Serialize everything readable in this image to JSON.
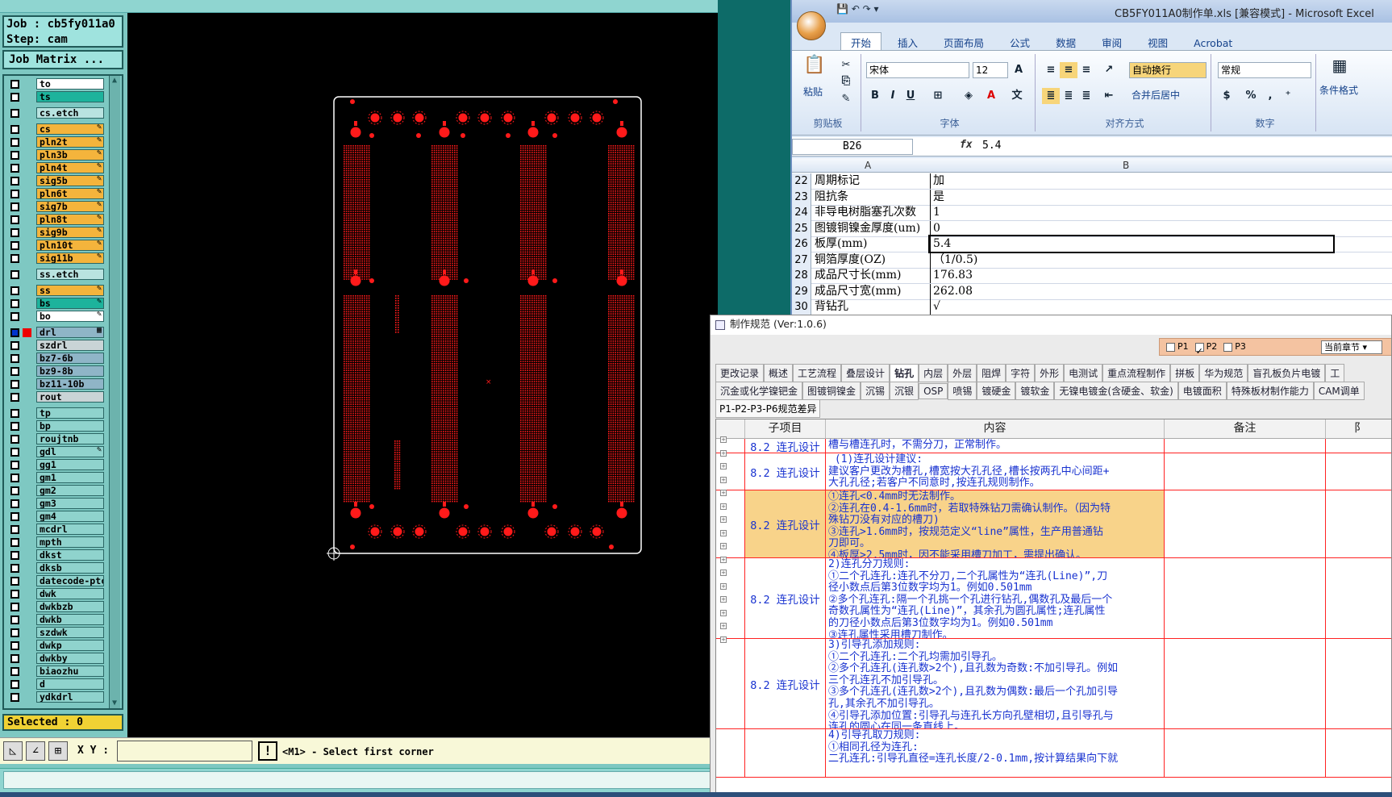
{
  "cam": {
    "job_line": "Job : cb5fy011a0",
    "step_line": "Step: cam",
    "job_matrix": "Job Matrix ...",
    "selected": "Selected : 0",
    "xy_label": "X Y :",
    "xy_value": "",
    "bang": "!",
    "prompt": "<M1> - Select first corner",
    "layers": [
      {
        "name": "to",
        "color": "white",
        "pen": ""
      },
      {
        "name": "ts",
        "color": "teal",
        "pen": ""
      },
      {
        "sep": true
      },
      {
        "name": "cs.etch",
        "color": "light",
        "pen": ""
      },
      {
        "sep": true
      },
      {
        "name": "cs",
        "color": "orange",
        "pen": "✎"
      },
      {
        "name": "pln2t",
        "color": "orange",
        "pen": "✎"
      },
      {
        "name": "pln3b",
        "color": "orange",
        "pen": "✎"
      },
      {
        "name": "pln4t",
        "color": "orange",
        "pen": "✎"
      },
      {
        "name": "sig5b",
        "color": "orange",
        "pen": "✎"
      },
      {
        "name": "pln6t",
        "color": "orange",
        "pen": "✎"
      },
      {
        "name": "sig7b",
        "color": "orange",
        "pen": "✎"
      },
      {
        "name": "pln8t",
        "color": "orange",
        "pen": "✎"
      },
      {
        "name": "sig9b",
        "color": "orange",
        "pen": "✎"
      },
      {
        "name": "pln10t",
        "color": "orange",
        "pen": "✎"
      },
      {
        "name": "sig11b",
        "color": "orange",
        "pen": "✎"
      },
      {
        "sep": true
      },
      {
        "name": "ss.etch",
        "color": "light",
        "pen": ""
      },
      {
        "sep": true
      },
      {
        "name": "ss",
        "color": "orange",
        "pen": "✎"
      },
      {
        "name": "bs",
        "color": "teal",
        "pen": "✎"
      },
      {
        "name": "bo",
        "color": "white",
        "pen": "✎"
      },
      {
        "sep": true
      },
      {
        "name": "drl",
        "color": "blue",
        "pen": "▦"
      },
      {
        "name": "szdrl",
        "color": "gray",
        "pen": ""
      },
      {
        "name": "bz7-6b",
        "color": "blue",
        "pen": ""
      },
      {
        "name": "bz9-8b",
        "color": "blue",
        "pen": ""
      },
      {
        "name": "bz11-10b",
        "color": "blue",
        "pen": ""
      },
      {
        "name": "rout",
        "color": "gray",
        "pen": ""
      },
      {
        "sep": true
      },
      {
        "name": "tp",
        "color": "cyan",
        "pen": ""
      },
      {
        "name": "bp",
        "color": "cyan",
        "pen": ""
      },
      {
        "name": "roujtnb",
        "color": "cyan",
        "pen": ""
      },
      {
        "name": "gdl",
        "color": "cyan",
        "pen": "✎"
      },
      {
        "name": "gg1",
        "color": "cyan",
        "pen": ""
      },
      {
        "name": "gm1",
        "color": "cyan",
        "pen": ""
      },
      {
        "name": "gm2",
        "color": "cyan",
        "pen": ""
      },
      {
        "name": "gm3",
        "color": "cyan",
        "pen": ""
      },
      {
        "name": "gm4",
        "color": "cyan",
        "pen": ""
      },
      {
        "name": "mcdrl",
        "color": "cyan",
        "pen": ""
      },
      {
        "name": "mpth",
        "color": "cyan",
        "pen": ""
      },
      {
        "name": "dkst",
        "color": "cyan",
        "pen": ""
      },
      {
        "name": "dksb",
        "color": "cyan",
        "pen": ""
      },
      {
        "name": "datecode-ptc",
        "color": "cyan",
        "pen": ""
      },
      {
        "name": "dwk",
        "color": "cyan",
        "pen": ""
      },
      {
        "name": "dwkbzb",
        "color": "cyan",
        "pen": ""
      },
      {
        "name": "dwkb",
        "color": "cyan",
        "pen": ""
      },
      {
        "name": "szdwk",
        "color": "cyan",
        "pen": ""
      },
      {
        "name": "dwkp",
        "color": "cyan",
        "pen": ""
      },
      {
        "name": "dwkby",
        "color": "cyan",
        "pen": ""
      },
      {
        "name": "biaozhu",
        "color": "cyan",
        "pen": ""
      },
      {
        "name": "d",
        "color": "cyan",
        "pen": ""
      },
      {
        "name": "ydkdrl",
        "color": "cyan",
        "pen": ""
      }
    ],
    "colors": {
      "white": "#ffffff",
      "teal": "#1db39c",
      "orange": "#f4b43c",
      "blue": "#8fb5c7",
      "gray": "#c9d4d6",
      "light": "#b9e3e0",
      "cyan": "#8fd3cd",
      "pad": "#ff1a1a"
    }
  },
  "excel": {
    "title": "CB5FY011A0制作单.xls [兼容模式] - Microsoft Excel",
    "tabs": [
      "开始",
      "插入",
      "页面布局",
      "公式",
      "数据",
      "审阅",
      "视图",
      "Acrobat"
    ],
    "font_name": "宋体",
    "font_size": "12",
    "wrap_text": "自动换行",
    "merge_center": "合并后居中",
    "number_format": "常规",
    "cond_format": "条件格式",
    "paste": "粘贴",
    "groups": {
      "clipboard": "剪贴板",
      "font": "字体",
      "align": "对齐方式",
      "number": "数字"
    },
    "name_box": "B26",
    "formula": "5.4",
    "col_a": "A",
    "col_b": "B",
    "rows": [
      {
        "n": "22",
        "a": "周期标记",
        "b": "加"
      },
      {
        "n": "23",
        "a": "阻抗条",
        "b": "是"
      },
      {
        "n": "24",
        "a": "非导电树脂塞孔次数",
        "b": "1"
      },
      {
        "n": "25",
        "a": "图镀铜镍金厚度(um)",
        "b": "0"
      },
      {
        "n": "26",
        "a": "板厚(mm)",
        "b": "5.4"
      },
      {
        "n": "27",
        "a": "铜箔厚度(OZ)",
        "b": "（1/0.5)"
      },
      {
        "n": "28",
        "a": "成品尺寸长(mm)",
        "b": "176.83"
      },
      {
        "n": "29",
        "a": "成品尺寸宽(mm)",
        "b": "262.08"
      },
      {
        "n": "30",
        "a": "背钻孔",
        "b": "√"
      }
    ]
  },
  "spec": {
    "title": "制作规范 (Ver:1.0.6)",
    "filters": [
      "P1",
      "P2",
      "P3"
    ],
    "chapter": "当前章节",
    "tabs1": [
      "更改记录",
      "概述",
      "工艺流程",
      "叠层设计",
      "钻孔",
      "内层",
      "外层",
      "阻焊",
      "字符",
      "外形",
      "电测试",
      "重点流程制作",
      "拼板",
      "华为规范",
      "盲孔板负片电镀",
      "工"
    ],
    "tabs2": [
      "沉金或化学镍钯金",
      "图镀铜镍金",
      "沉锡",
      "沉银",
      "OSP",
      "喷锡",
      "镀硬金",
      "镀软金",
      "无镍电镀金(含硬金、软金)",
      "电镀面积",
      "特殊板材制作能力",
      "CAM调单"
    ],
    "tab3": "P1-P2-P3-P6规范差异",
    "headers": {
      "sub": "子项目",
      "content": "内容",
      "note": "备注",
      "last": "阝"
    },
    "rows": [
      {
        "sub": "8.2 连孔设计",
        "content": "槽与槽连孔时，不需分刀，正常制作。",
        "h": 18,
        "hl": false
      },
      {
        "sub": "8.2 连孔设计",
        "content": " (1)连孔设计建议:\n建议客户更改为槽孔,槽宽按大孔孔径,槽长按两孔中心间距+\n大孔孔径;若客户不同意时,按连孔规则制作。",
        "h": 46,
        "hl": false
      },
      {
        "sub": "8.2 连孔设计",
        "content": "①连孔<0.4mm时无法制作。\n②连孔在0.4-1.6mm时，若取特殊钻刀需确认制作。（因为特\n殊钻刀没有对应的槽刀)\n③连孔>1.6mm时，按规范定义“line”属性，生产用普通钻\n刀即可。\n④板厚>2.5mm时，因不能采用槽刀加工，需提出确认。",
        "h": 84,
        "hl": true
      },
      {
        "sub": "8.2 连孔设计",
        "content": "2)连孔分刀规则:\n①二个孔连孔:连孔不分刀,二个孔属性为“连孔(Line)”,刀\n径小数点后第3位数字均为1。例如0.501mm\n②多个孔连孔:隔一个孔挑一个孔进行钻孔,偶数孔及最后一个\n奇数孔属性为“连孔(Line)”，其余孔为圆孔属性;连孔属性\n的刀径小数点后第3位数字均为1。例如0.501mm\n③连孔属性采用槽刀制作。",
        "h": 100,
        "hl": false
      },
      {
        "sub": "8.2 连孔设计",
        "content": "3)引导孔添加规则:\n①二个孔连孔:二个孔均需加引导孔。\n②多个孔连孔(连孔数>2个),且孔数为奇数:不加引导孔。例如\n三个孔连孔不加引导孔。\n③多个孔连孔(连孔数>2个),且孔数为偶数:最后一个孔加引导\n孔,其余孔不加引导孔。\n④引导孔添加位置:引导孔与连孔长方向孔壁相切,且引导孔与\n连孔的圆心在同一条直线上。",
        "h": 112,
        "hl": false
      },
      {
        "sub": "",
        "content": "4)引导孔取刀规则:\n①相同孔径为连孔:\n二孔连孔:引导孔直径=连孔长度/2-0.1mm,按计算结果向下就",
        "h": 60,
        "hl": false
      }
    ]
  }
}
